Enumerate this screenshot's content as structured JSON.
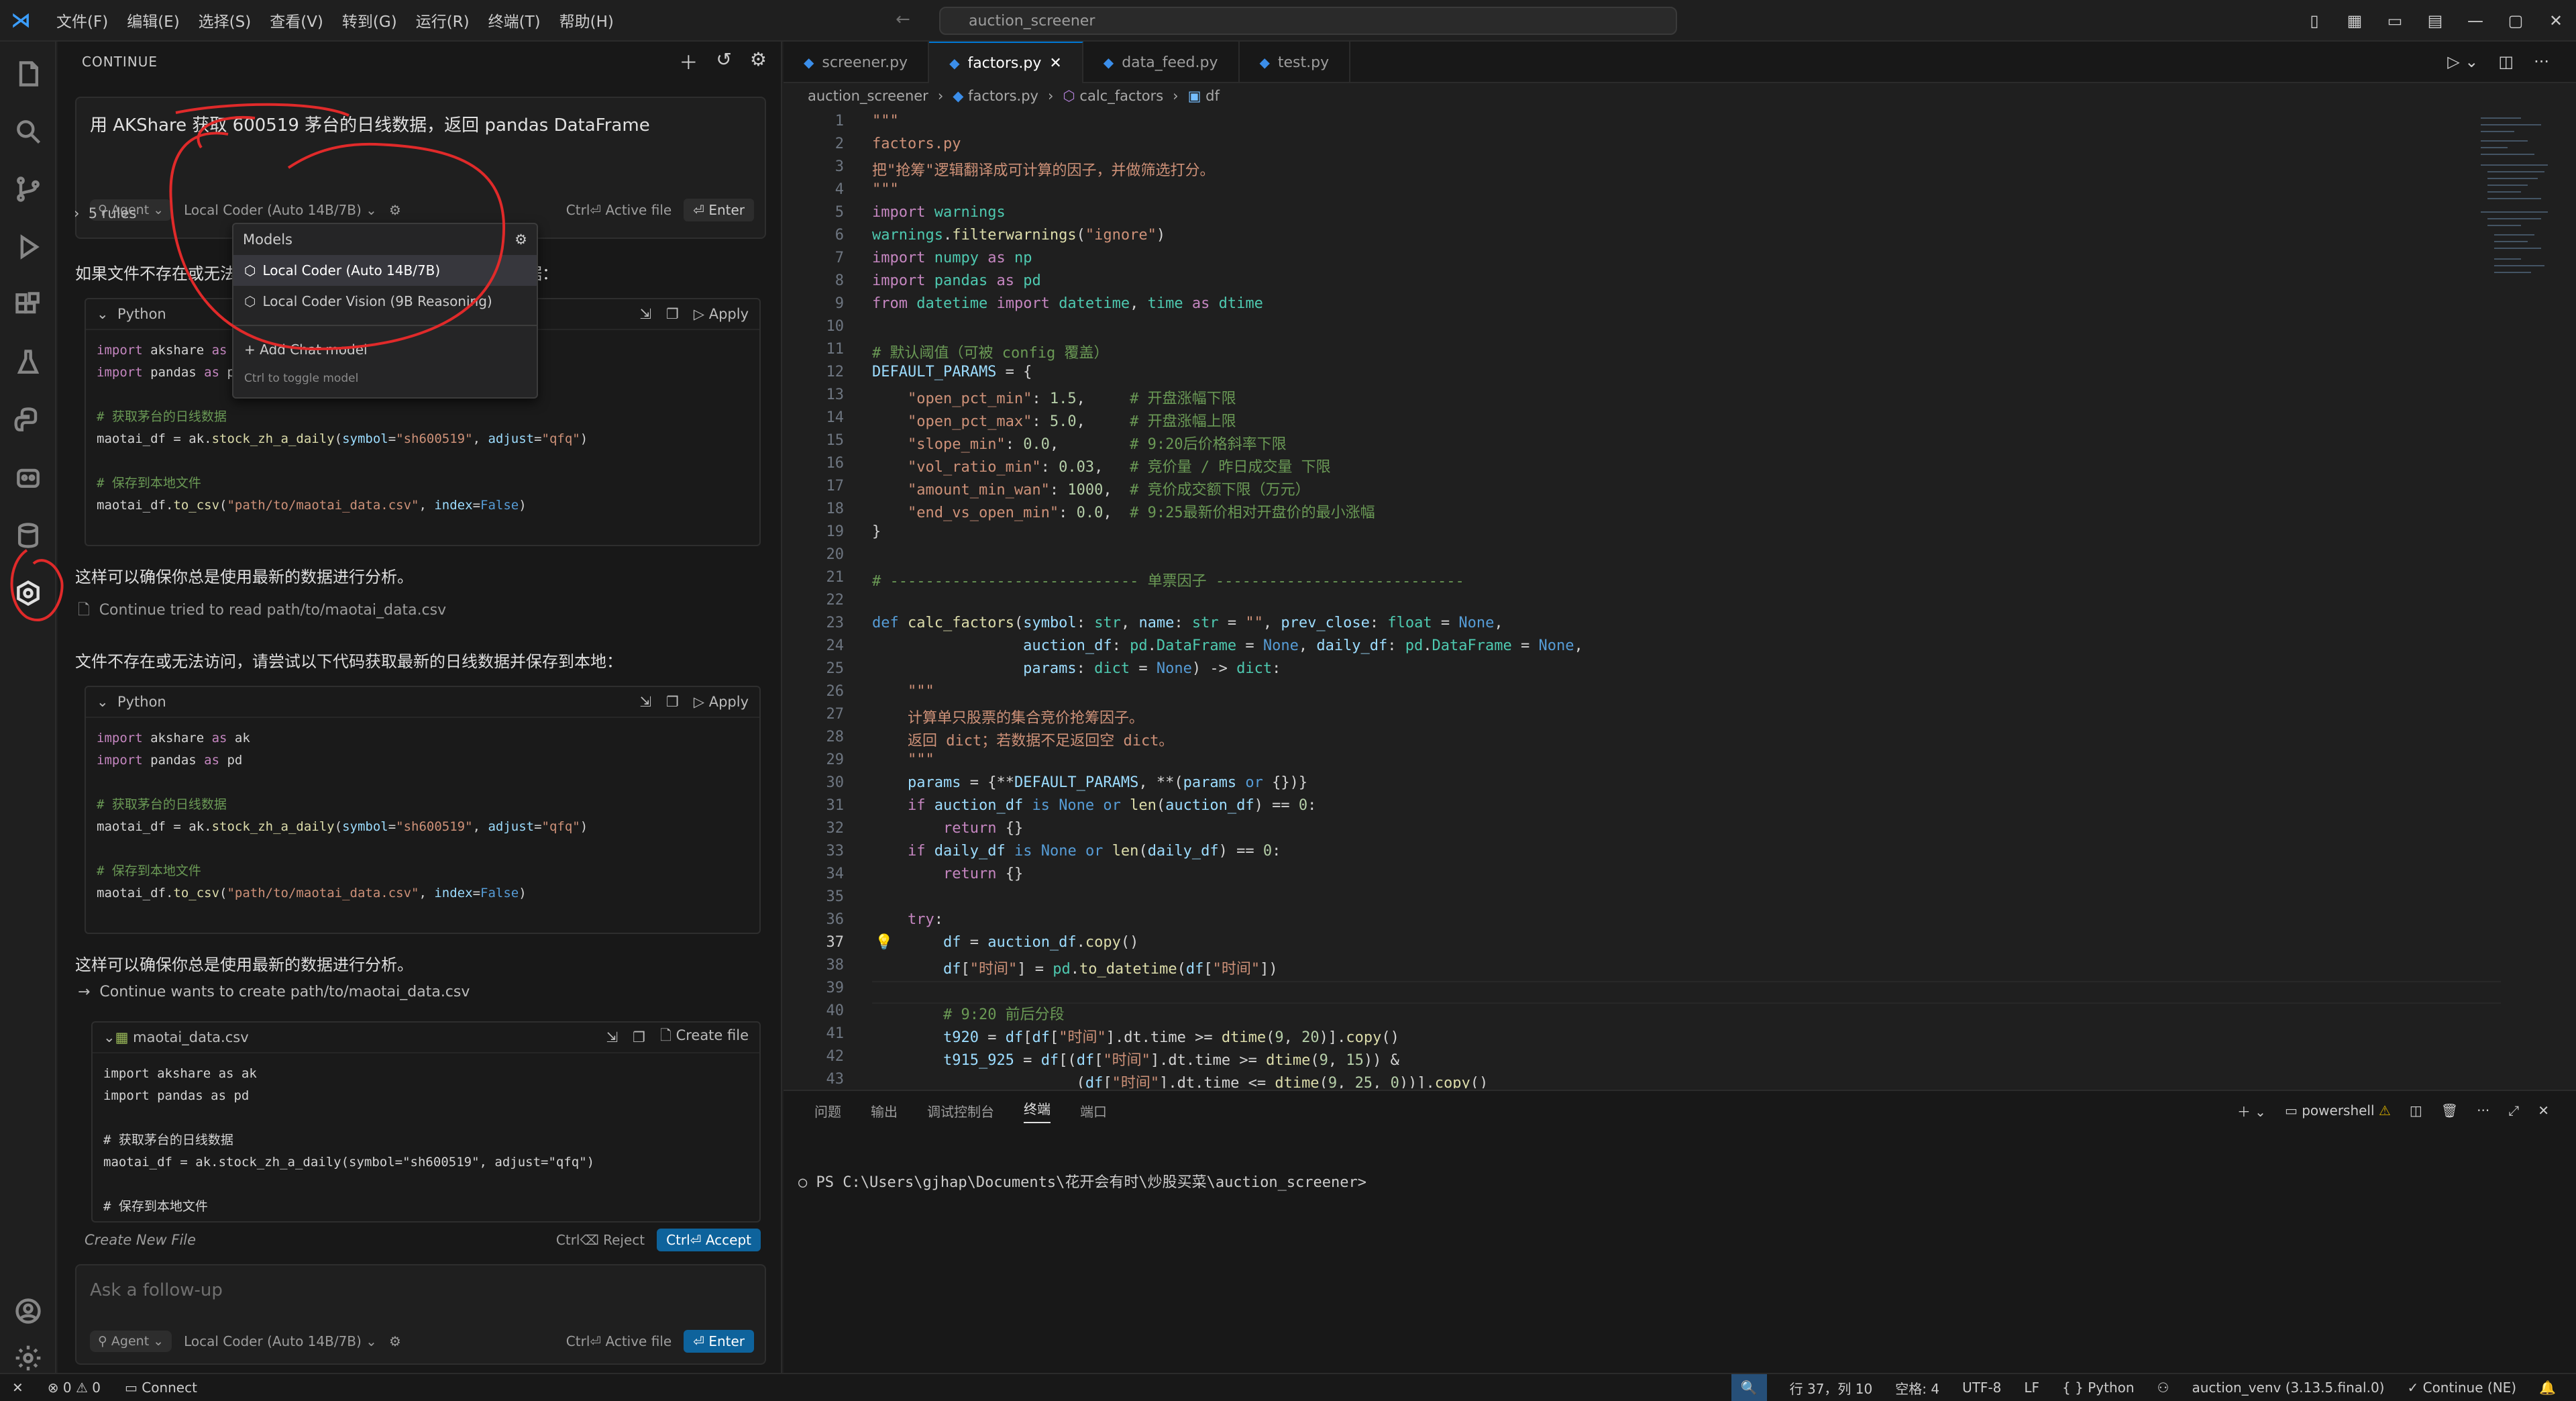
{
  "titlebar": {
    "menus": [
      "文件(F)",
      "编辑(E)",
      "选择(S)",
      "查看(V)",
      "转到(G)",
      "运行(R)",
      "终端(T)",
      "帮助(H)"
    ],
    "search_text": "auction_screener"
  },
  "sidebar": {
    "title": "CONTINUE",
    "prompt": "用 AKShare 获取 600519 茅台的日线数据，返回 pandas DataFrame",
    "agent_label": "Agent",
    "model_label": "Local Coder (Auto 14B/7B)",
    "active_file": "Ctrl⏎ Active file",
    "enter": "Enter",
    "rules": "5 rules",
    "para1": "如果文件不存在或无法访问，请尝试以下代码获取最新的日线数据：",
    "lang1": "Python",
    "apply": "Apply",
    "para2": "这样可以确保你总是使用最新的数据进行分析。",
    "tool1": "Continue tried to read path/to/maotai_data.csv",
    "para3": "文件不存在或无法访问，请尝试以下代码获取最新的日线数据并保存到本地：",
    "lang2": "Python",
    "para4": "这样可以确保你总是使用最新的数据进行分析。",
    "tool2": "Continue wants to create path/to/maotai_data.csv",
    "file_label": "maotai_data.csv",
    "create_file": "Create file",
    "create_new_file": "Create New File",
    "reject": "Ctrl⌫ Reject",
    "accept": "Ctrl⏎ Accept",
    "followup_placeholder": "Ask a follow-up",
    "followup_agent": "Agent",
    "followup_model": "Local Coder (Auto 14B/7B)",
    "followup_active": "Ctrl⏎ Active file",
    "followup_enter": "Enter",
    "dropdown": {
      "title": "Models",
      "items": [
        "Local Coder (Auto 14B/7B)",
        "Local Coder Vision (9B Reasoning)"
      ],
      "add": "+ Add Chat model",
      "hint": "Ctrl  to toggle model"
    }
  },
  "editor": {
    "tabs": [
      "screener.py",
      "factors.py",
      "data_feed.py",
      "test.py"
    ],
    "breadcrumb": [
      "auction_screener",
      "factors.py",
      "calc_factors",
      "df"
    ]
  },
  "panel": {
    "tabs": [
      "问题",
      "输出",
      "调试控制台",
      "终端",
      "端口"
    ],
    "shell": "powershell",
    "prompt": "PS C:\\Users\\gjhap\\Documents\\花开会有时\\炒股买菜\\auction_screener>"
  },
  "statusbar": {
    "errors": "⊗ 0 ⚠ 0",
    "connect": "Connect",
    "position": "行 37，列 10",
    "spaces": "空格: 4",
    "encoding": "UTF-8",
    "eol": "LF",
    "language": "{ } Python",
    "venv": "auction_venv (3.13.5.final.0)",
    "continue": "✓ Continue (NE)"
  }
}
